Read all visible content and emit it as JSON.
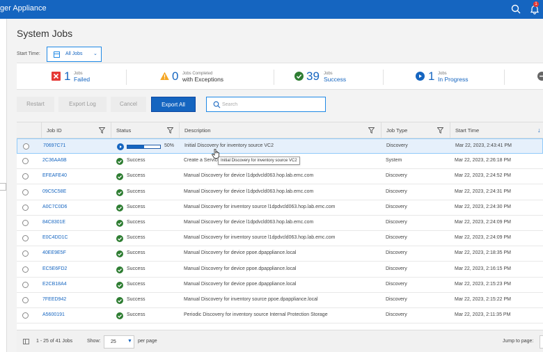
{
  "header": {
    "app_title": "ger Appliance",
    "search_icon": "search-icon",
    "bell_icon": "bell-icon",
    "notification_count": "1"
  },
  "page": {
    "title": "System Jobs",
    "start_time_label": "Start Time:",
    "start_time_value": "All Jobs"
  },
  "summary": {
    "failed": {
      "count": "1",
      "small": "Jobs",
      "label": "Failed",
      "color": "#e53935"
    },
    "exceptions": {
      "count": "0",
      "small": "Jobs Completed",
      "label": "with Exceptions",
      "color": "#f5a623"
    },
    "success": {
      "count": "39",
      "small": "Jobs",
      "label": "Success",
      "color": "#2e7d32"
    },
    "in_progress": {
      "count": "1",
      "small": "Jobs",
      "label": "In Progress",
      "color": "#1565c0"
    }
  },
  "toolbar": {
    "restart": "Restart",
    "export_log": "Export Log",
    "cancel": "Cancel",
    "export_all": "Export All",
    "search_placeholder": "Search"
  },
  "table": {
    "columns": {
      "job_id": "Job ID",
      "status": "Status",
      "description": "Description",
      "job_type": "Job Type",
      "start_time": "Start Time"
    },
    "rows": [
      {
        "id": "70697C71",
        "status": "50%",
        "progress": 0.5,
        "desc": "Initial Discovery for inventory source VC2",
        "type": "Discovery",
        "time": "Mar 22, 2023, 2:43:41 PM"
      },
      {
        "id": "2C36AA6B",
        "status": "Success",
        "desc": "Create a Service",
        "type": "System",
        "time": "Mar 22, 2023, 2:26:18 PM"
      },
      {
        "id": "EFEAFE40",
        "status": "Success",
        "desc": "Manual Discovery for device l1dpdvcld063.hop.lab.emc.com",
        "type": "Discovery",
        "time": "Mar 22, 2023, 2:24:52 PM"
      },
      {
        "id": "09C5C58E",
        "status": "Success",
        "desc": "Manual Discovery for device l1dpdvcld063.hop.lab.emc.com",
        "type": "Discovery",
        "time": "Mar 22, 2023, 2:24:31 PM"
      },
      {
        "id": "A0C7C0D6",
        "status": "Success",
        "desc": "Manual Discovery for inventory source l1dpdvcld063.hop.lab.emc.com",
        "type": "Discovery",
        "time": "Mar 22, 2023, 2:24:30 PM"
      },
      {
        "id": "84C8301E",
        "status": "Success",
        "desc": "Manual Discovery for device l1dpdvcld063.hop.lab.emc.com",
        "type": "Discovery",
        "time": "Mar 22, 2023, 2:24:09 PM"
      },
      {
        "id": "E0C4DD1C",
        "status": "Success",
        "desc": "Manual Discovery for inventory source l1dpdvcld063.hop.lab.emc.com",
        "type": "Discovery",
        "time": "Mar 22, 2023, 2:24:09 PM"
      },
      {
        "id": "40EE9E5F",
        "status": "Success",
        "desc": "Manual Discovery for device ppoe.dpappliance.local",
        "type": "Discovery",
        "time": "Mar 22, 2023, 2:18:35 PM"
      },
      {
        "id": "EC5E6FD2",
        "status": "Success",
        "desc": "Manual Discovery for device ppoe.dpappliance.local",
        "type": "Discovery",
        "time": "Mar 22, 2023, 2:16:15 PM"
      },
      {
        "id": "E2CB18A4",
        "status": "Success",
        "desc": "Manual Discovery for device ppoe.dpappliance.local",
        "type": "Discovery",
        "time": "Mar 22, 2023, 2:15:23 PM"
      },
      {
        "id": "7FEED942",
        "status": "Success",
        "desc": "Manual Discovery for inventory source ppoe.dpappliance.local",
        "type": "Discovery",
        "time": "Mar 22, 2023, 2:15:22 PM"
      },
      {
        "id": "A5600191",
        "status": "Success",
        "desc": "Periodic Discovery for inventory source Internal Protection Storage",
        "type": "Discovery",
        "time": "Mar 22, 2023, 2:11:35 PM"
      }
    ]
  },
  "tooltip": "Initial Discovery for inventory source VC2",
  "footer": {
    "range": "1 - 25 of 41 Jobs",
    "show_label": "Show:",
    "page_size": "25",
    "per_page": "per page",
    "jump_label": "Jump to page:"
  }
}
